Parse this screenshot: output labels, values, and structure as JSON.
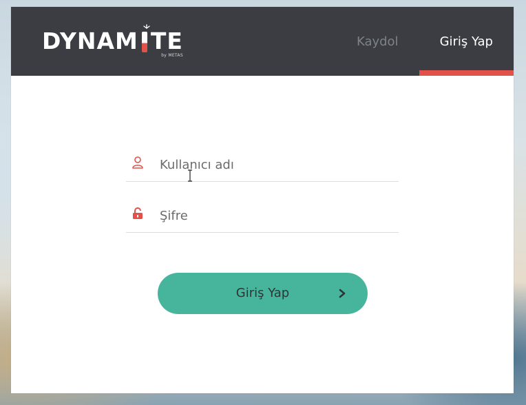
{
  "header": {
    "logo": {
      "name": "DYNAMITE",
      "tagline": "by METAS"
    },
    "nav": [
      {
        "label": "Kaydol",
        "active": false
      },
      {
        "label": "Giriş Yap",
        "active": true
      }
    ]
  },
  "form": {
    "username": {
      "placeholder": "Kullanıcı adı",
      "value": "",
      "icon": "user-icon"
    },
    "password": {
      "placeholder": "Şifre",
      "value": "",
      "icon": "unlock-icon"
    },
    "submit": {
      "label": "Giriş Yap",
      "icon": "chevron-right-icon"
    }
  },
  "colors": {
    "header_bg": "#3b3d43",
    "accent_red": "#e2524a",
    "button_green": "#47b59b",
    "inactive_nav": "#7d838a"
  }
}
